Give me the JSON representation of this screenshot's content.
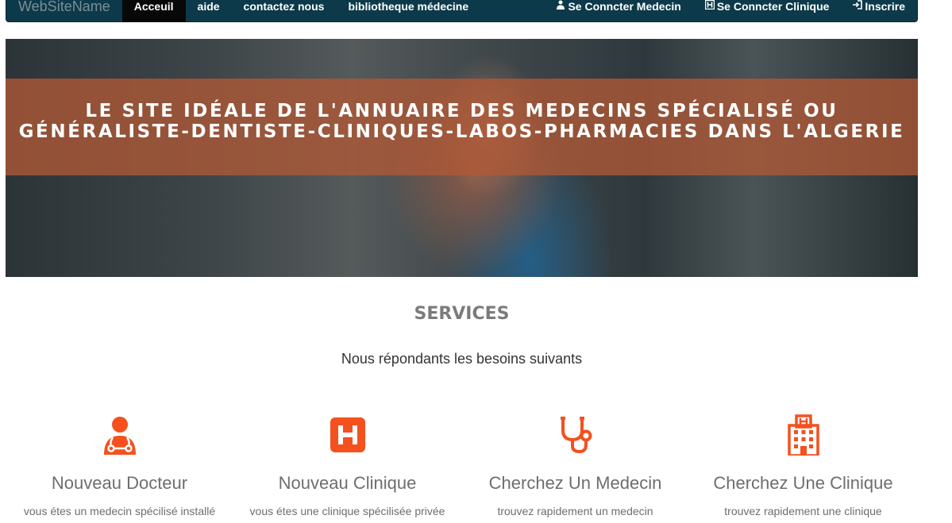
{
  "nav": {
    "brand": "WebSiteName",
    "items": [
      {
        "label": "Acceuil",
        "active": true
      },
      {
        "label": "aide"
      },
      {
        "label": "contactez nous"
      },
      {
        "label": "bibliotheque médecine"
      }
    ],
    "right": [
      {
        "icon": "doctor-icon",
        "label": "Se Conncter Medecin"
      },
      {
        "icon": "hospital-icon",
        "label": "Se Conncter Clinique"
      },
      {
        "icon": "login-icon",
        "label": "Inscrire"
      }
    ]
  },
  "hero": {
    "title": "Le site idéale de l'annuaire des medecins spécialisé ou généraliste-dentiste-cliniques-labos-pharmacies dans l'Algerie"
  },
  "services": {
    "title": "SERVICES",
    "subtitle": "Nous répondants les besoins suivants",
    "accent_color": "#f4511e",
    "items": [
      {
        "icon": "doctor-icon",
        "name": "Nouveau Docteur",
        "desc": "vous étes un medecin spécilisé installé"
      },
      {
        "icon": "hospital-square-icon",
        "name": "Nouveau Clinique",
        "desc": "vous étes une clinique spécilisée privée"
      },
      {
        "icon": "stethoscope-icon",
        "name": "Cherchez Un Medecin",
        "desc": "trouvez rapidement un medecin"
      },
      {
        "icon": "hospital-building-icon",
        "name": "Cherchez Une Clinique",
        "desc": "trouvez rapidement une clinique"
      }
    ]
  }
}
